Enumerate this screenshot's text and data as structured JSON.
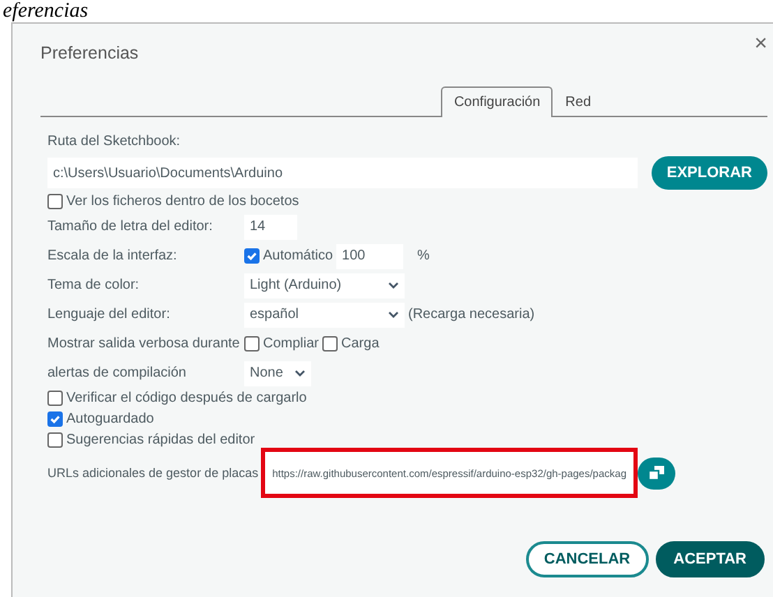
{
  "heading_fragment": "eferencias",
  "dialog": {
    "title": "Preferencias",
    "close": "×"
  },
  "tabs": [
    {
      "label": "Configuración",
      "selected": true
    },
    {
      "label": "Red",
      "selected": false
    }
  ],
  "sketchbook": {
    "label": "Ruta del Sketchbook:",
    "value": "c:\\Users\\Usuario\\Documents\\Arduino",
    "button": "EXPLORAR"
  },
  "show_files": {
    "label": "Ver los ficheros dentro de los bocetos",
    "checked": false
  },
  "rows": [
    {
      "kind": "text",
      "label": "Tamaño de letra del editor:",
      "value": "14"
    },
    {
      "kind": "scale",
      "label": "Escala de la interfaz:",
      "check_label": "Automático",
      "checked": true,
      "value": "100",
      "unit": "%"
    },
    {
      "kind": "select",
      "label": "Tema de color:",
      "value": "Light (Arduino)"
    },
    {
      "kind": "select",
      "label": "Lenguaje del editor:",
      "value": "español",
      "note": "(Recarga necesaria)"
    },
    {
      "kind": "checks",
      "label": "Mostrar salida verbosa durante",
      "options": [
        {
          "label": "Compliar",
          "checked": false
        },
        {
          "label": "Carga",
          "checked": false
        }
      ]
    },
    {
      "kind": "select-small",
      "label": "alertas de compilación",
      "value": "None"
    }
  ],
  "options": [
    {
      "label": "Verificar el código después de cargarlo",
      "checked": false
    },
    {
      "label": "Autoguardado",
      "checked": true
    },
    {
      "label": "Sugerencias rápidas del editor",
      "checked": false
    }
  ],
  "board_urls": {
    "label": "URLs adicionales de gestor de placas",
    "value": "https://raw.githubusercontent.com/espressif/arduino-esp32/gh-pages/packag",
    "highlighted": true
  },
  "buttons": [
    {
      "label": "CANCELAR",
      "kind": "secondary"
    },
    {
      "label": "ACEPTAR",
      "kind": "primary"
    }
  ]
}
